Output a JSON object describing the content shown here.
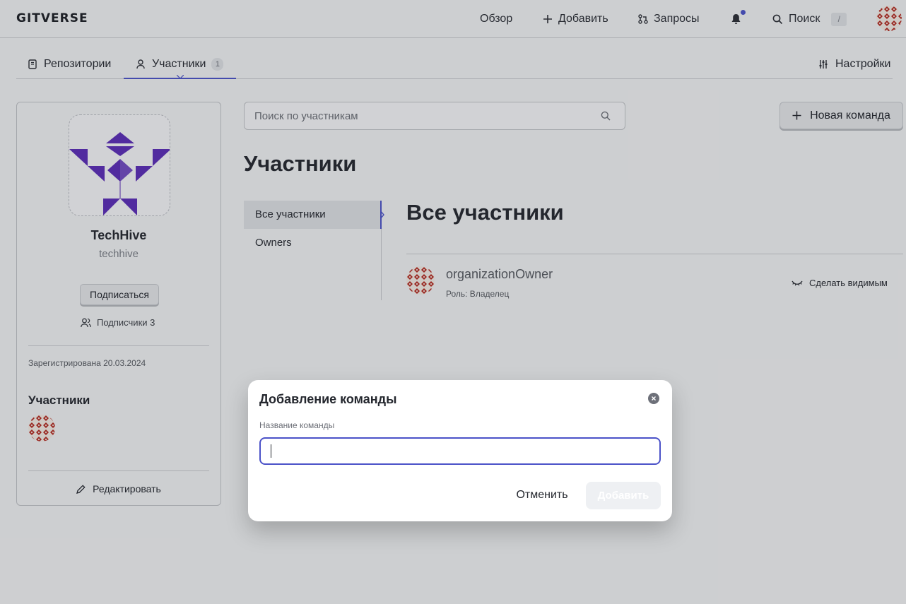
{
  "header": {
    "logo": "GITVERSE",
    "nav": {
      "overview": "Обзор",
      "add": "Добавить",
      "requests": "Запросы",
      "search": "Поиск",
      "search_shortcut": "/"
    }
  },
  "tabs": {
    "repositories": "Репозитории",
    "members": "Участники",
    "members_count": "1",
    "settings": "Настройки"
  },
  "org": {
    "name": "TechHive",
    "slug": "techhive",
    "subscribe_label": "Подписаться",
    "followers": "Подписчики 3",
    "registered": "Зарегистрирована 20.03.2024",
    "members_title": "Участники",
    "edit_label": "Редактировать"
  },
  "main": {
    "search_placeholder": "Поиск по участникам",
    "new_team_label": "Новая команда",
    "title": "Участники",
    "side_nav": [
      "Все участники",
      "Owners"
    ],
    "section_title": "Все участники",
    "members": [
      {
        "name": "organizationOwner",
        "role": "Роль: Владелец",
        "action": "Сделать видимым"
      }
    ]
  },
  "modal": {
    "title": "Добавление команды",
    "field_label": "Название команды",
    "field_value": "",
    "cancel_label": "Отменить",
    "submit_label": "Добавить"
  },
  "colors": {
    "accent": "#4b52c8",
    "logo_purple": "#5b2bb8",
    "avatar_red": "#b3261e"
  }
}
